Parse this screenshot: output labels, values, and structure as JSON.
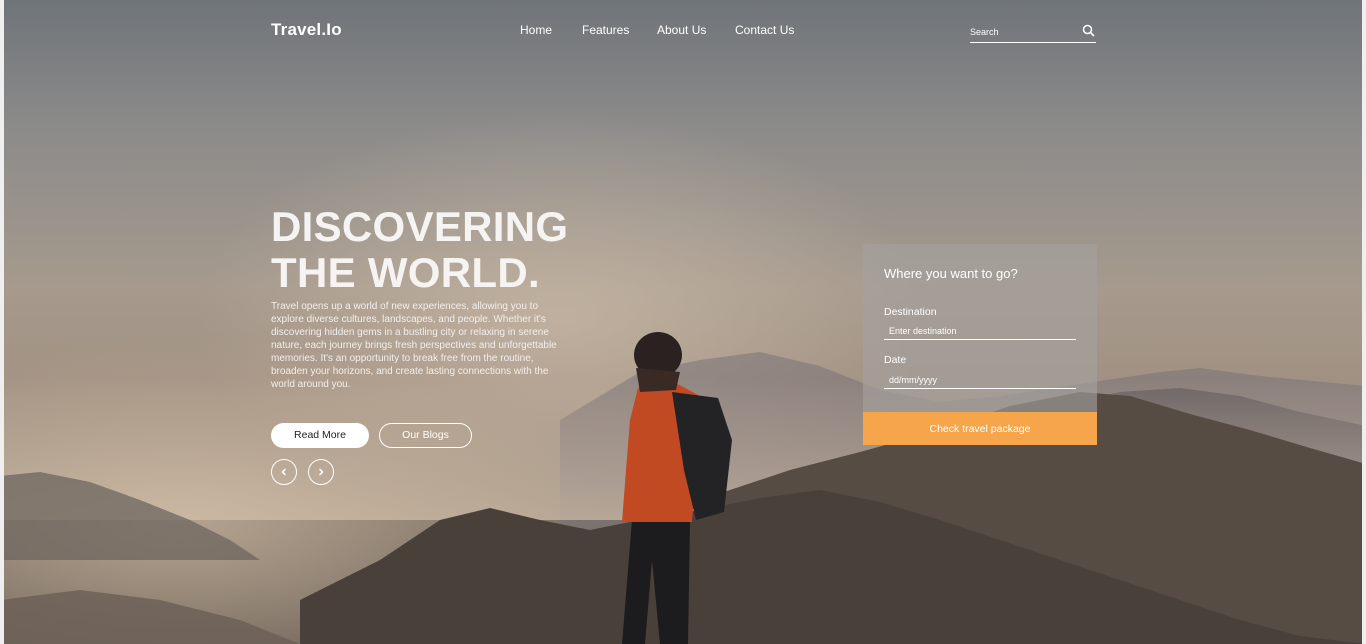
{
  "brand": "Travel.Io",
  "nav": {
    "home": "Home",
    "features": "Features",
    "about": "About Us",
    "contact": "Contact Us"
  },
  "search": {
    "placeholder": "Search",
    "icon": "search-icon"
  },
  "hero": {
    "headline_line1": "DISCOVERING",
    "headline_line2": "THE WORLD.",
    "body": "Travel opens up a world of new experiences, allowing you to explore diverse cultures, landscapes, and people. Whether it's discovering hidden gems in a bustling city or relaxing in serene nature, each journey brings fresh perspectives and unforgettable memories. It's an opportunity to break free from the routine, broaden your horizons, and create lasting connections with the world around you.",
    "read_more": "Read More",
    "our_blogs": "Our Blogs",
    "prev_icon": "chevron-left-icon",
    "next_icon": "chevron-right-icon"
  },
  "booking": {
    "title": "Where you want to go?",
    "destination_label": "Destination",
    "destination_placeholder": "Enter destination",
    "date_label": "Date",
    "date_placeholder": "dd/mm/yyyy",
    "submit": "Check travel package"
  },
  "colors": {
    "accent": "#f6a54a",
    "text": "#ffffff"
  }
}
